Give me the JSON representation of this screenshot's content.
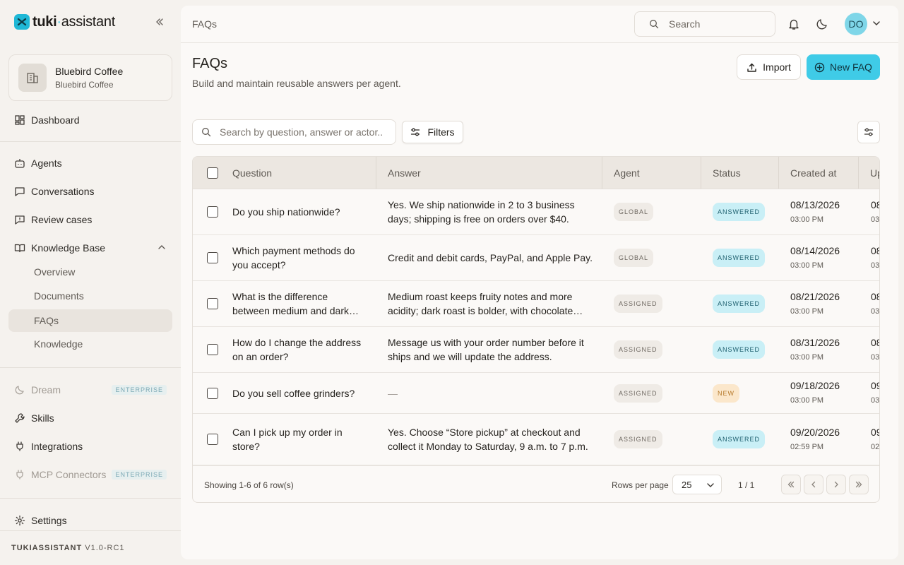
{
  "app": {
    "logo_bold": "tuki",
    "logo_dot": "·",
    "logo_light": "assistant"
  },
  "org": {
    "name": "Bluebird Coffee",
    "subtitle": "Bluebird Coffee"
  },
  "nav": {
    "dashboard": "Dashboard",
    "agents": "Agents",
    "conversations": "Conversations",
    "review_cases": "Review cases",
    "knowledge_base": "Knowledge Base",
    "kb_overview": "Overview",
    "kb_documents": "Documents",
    "kb_faqs": "FAQs",
    "kb_knowledge": "Knowledge",
    "dream": "Dream",
    "skills": "Skills",
    "integrations": "Integrations",
    "mcp": "MCP Connectors",
    "enterprise_badge": "ENTERPRISE",
    "settings": "Settings"
  },
  "version": {
    "name": "TUKIASSISTANT",
    "number": "V1.0-RC1"
  },
  "topbar": {
    "breadcrumb": "FAQs",
    "search_placeholder": "Search",
    "avatar_initials": "DO"
  },
  "page": {
    "title": "FAQs",
    "subtitle": "Build and maintain reusable answers per agent.",
    "import_label": "Import",
    "new_label": "New FAQ",
    "search_placeholder": "Search by question, answer or actor..",
    "filters_label": "Filters"
  },
  "table": {
    "columns": {
      "question": "Question",
      "answer": "Answer",
      "agent": "Agent",
      "status": "Status",
      "created": "Created at",
      "updated": "Up"
    },
    "rows": [
      {
        "question": "Do you ship nationwide?",
        "answer": "Yes. We ship nationwide in 2 to 3 business days; shipping is free on orders over $40.",
        "agent": "GLOBAL",
        "status": "ANSWERED",
        "created_date": "08/13/2026",
        "created_time": "03:00 PM",
        "updated_date": "08/",
        "updated_time": "03:"
      },
      {
        "question": "Which payment methods do you accept?",
        "answer": "Credit and debit cards, PayPal, and Apple Pay.",
        "agent": "GLOBAL",
        "status": "ANSWERED",
        "created_date": "08/14/2026",
        "created_time": "03:00 PM",
        "updated_date": "08/",
        "updated_time": "03:"
      },
      {
        "question": "What is the difference between medium and dark roast?",
        "answer": "Medium roast keeps fruity notes and more acidity; dark roast is bolder, with chocolate notes.",
        "agent": "ASSIGNED",
        "status": "ANSWERED",
        "created_date": "08/21/2026",
        "created_time": "03:00 PM",
        "updated_date": "08/",
        "updated_time": "03:"
      },
      {
        "question": "How do I change the address on an order?",
        "answer": "Message us with your order number before it ships and we will update the address.",
        "agent": "ASSIGNED",
        "status": "ANSWERED",
        "created_date": "08/31/2026",
        "created_time": "03:00 PM",
        "updated_date": "08/",
        "updated_time": "03:"
      },
      {
        "question": "Do you sell coffee grinders?",
        "answer": "—",
        "agent": "ASSIGNED",
        "status": "NEW",
        "created_date": "09/18/2026",
        "created_time": "03:00 PM",
        "updated_date": "09/",
        "updated_time": "03:"
      },
      {
        "question": "Can I pick up my order in store?",
        "answer": "Yes. Choose “Store pickup” at checkout and collect it Monday to Saturday, 9 a.m. to 7 p.m.",
        "agent": "ASSIGNED",
        "status": "ANSWERED",
        "created_date": "09/20/2026",
        "created_time": "02:59 PM",
        "updated_date": "09/",
        "updated_time": "02:"
      }
    ]
  },
  "pagination": {
    "showing": "Showing 1-6 of 6 row(s)",
    "rows_per_page_label": "Rows per page",
    "rows_per_page": "25",
    "page_indicator": "1 / 1"
  }
}
